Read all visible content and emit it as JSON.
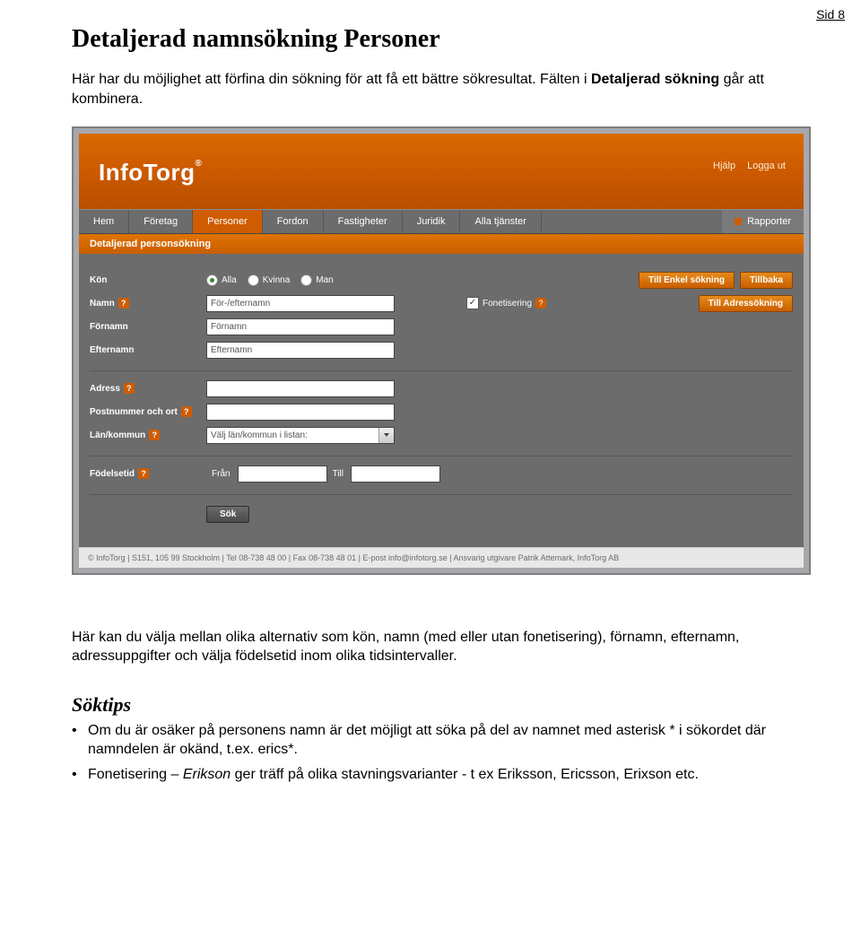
{
  "pageNumber": "Sid 8",
  "title": "Detaljerad namnsökning Personer",
  "intro_before": "Här har du möjlighet att förfina din sökning för att få ett bättre sökresultat. Fälten i ",
  "intro_bold": "Detaljerad sökning",
  "intro_after": " går att kombinera.",
  "after_img": "Här kan du välja mellan olika alternativ som kön, namn (med eller utan fonetisering), förnamn, efternamn, adressuppgifter och välja födelsetid inom olika tidsintervaller.",
  "soktips_heading": "Söktips",
  "bullet1": "Om du är osäker på personens namn är det möjligt att söka på del av namnet med asterisk * i sökordet där namndelen är okänd, t.ex. erics*.",
  "bullet2_before": "Fonetisering – ",
  "bullet2_italic": "Erikson",
  "bullet2_after": " ger träff på olika stavningsvarianter - t ex Eriksson, Ericsson, Erixson etc.",
  "screenshot": {
    "logo": "InfoTorg",
    "topLinks": {
      "hjalp": "Hjälp",
      "loggaut": "Logga ut"
    },
    "nav": {
      "hem": "Hem",
      "foretag": "Företag",
      "personer": "Personer",
      "fordon": "Fordon",
      "fastigheter": "Fastigheter",
      "juridik": "Juridik",
      "alla": "Alla tjänster",
      "rapporter": "Rapporter"
    },
    "subTitle": "Detaljerad personsökning",
    "form": {
      "kon_label": "Kön",
      "kon_opts": {
        "alla": "Alla",
        "kvinna": "Kvinna",
        "man": "Man"
      },
      "namn_label": "Namn",
      "namn_placeholder": "För-/efternamn",
      "fonetisering_label": "Fonetisering",
      "fornamn_label": "Förnamn",
      "fornamn_placeholder": "Förnamn",
      "efternamn_label": "Efternamn",
      "efternamn_placeholder": "Efternamn",
      "adress_label": "Adress",
      "post_label": "Postnummer och ort",
      "lan_label": "Län/kommun",
      "lan_placeholder": "Välj län/kommun i listan:",
      "fodelse_label": "Födelsetid",
      "fran_label": "Från",
      "till_label": "Till",
      "sok_btn": "Sök",
      "btn_enkel": "Till Enkel sökning",
      "btn_tillbaka": "Tillbaka",
      "btn_adress": "Till Adressökning"
    },
    "footer": "© InfoTorg | S151, 105 99 Stockholm | Tel 08-738 48 00 | Fax 08-738 48 01 | E-post info@infotorg.se | Ansvarig utgivare Patrik Attemark, InfoTorg AB"
  }
}
